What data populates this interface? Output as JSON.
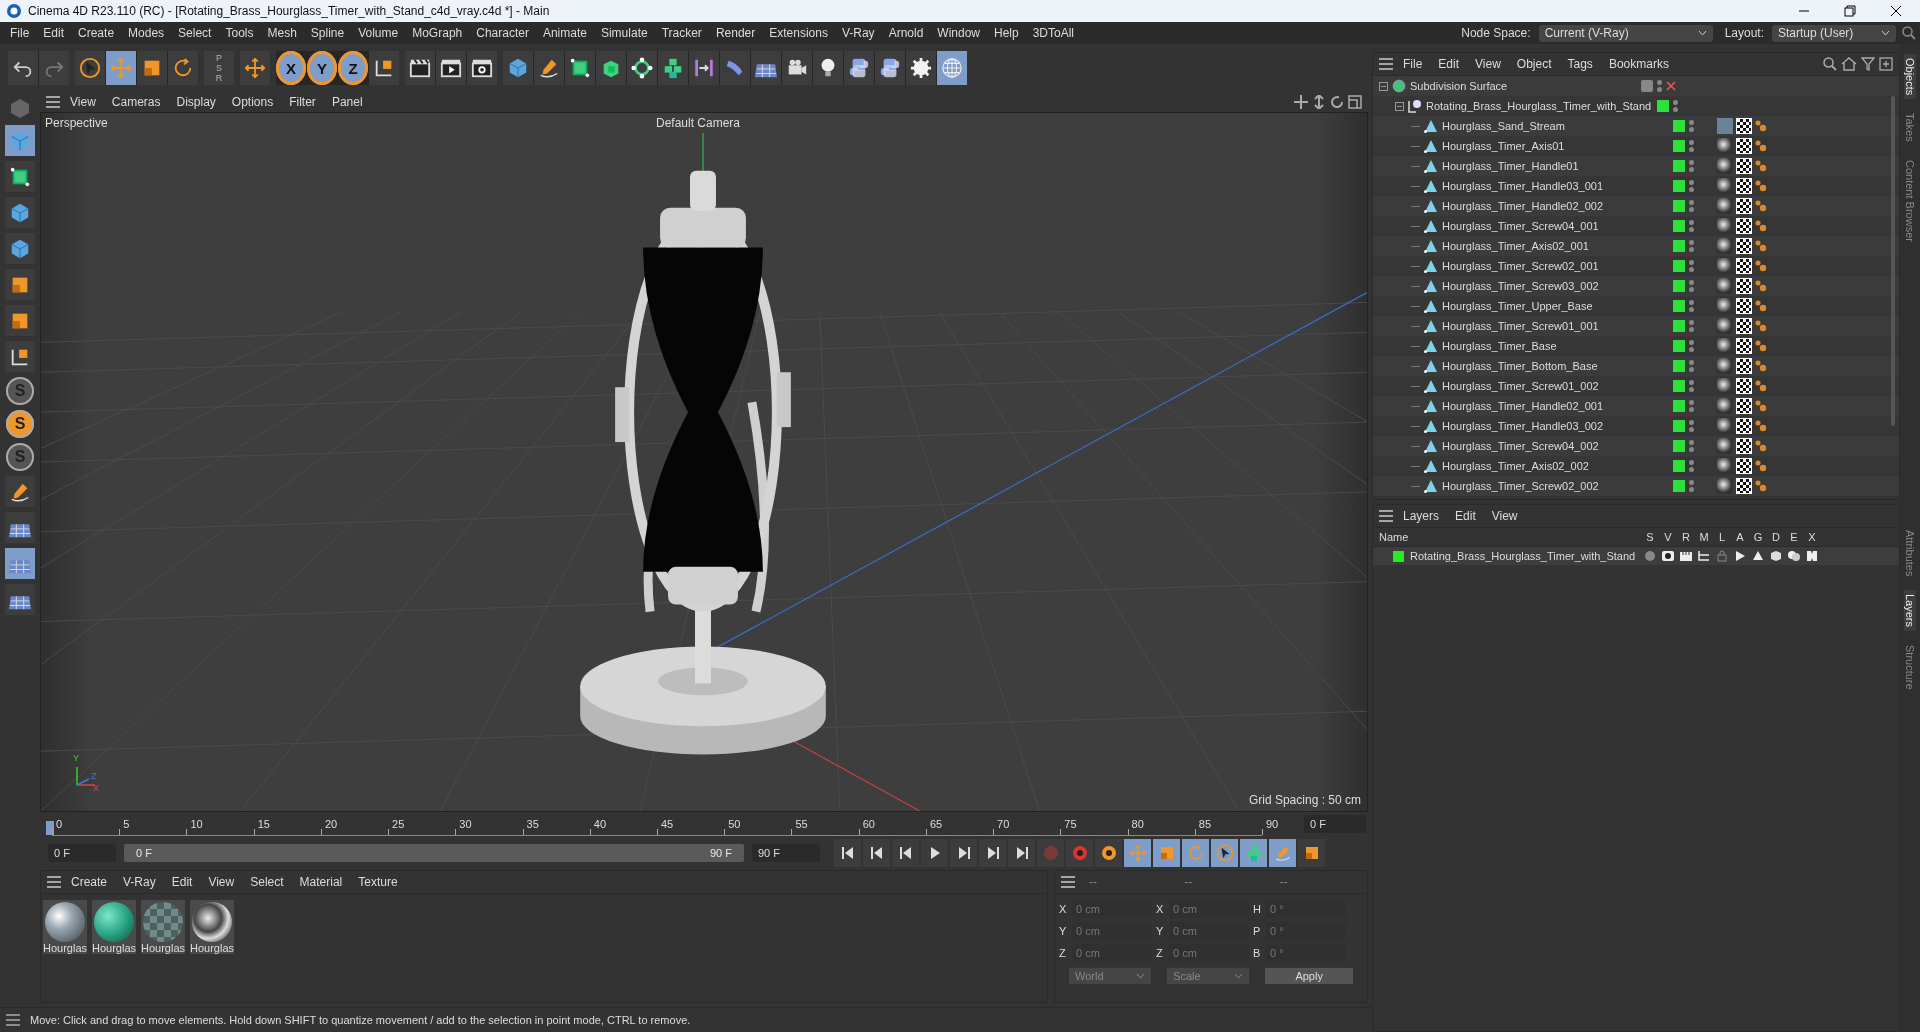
{
  "window": {
    "title": "Cinema 4D R23.110 (RC) - [Rotating_Brass_Hourglass_Timer_with_Stand_c4d_vray.c4d *] - Main"
  },
  "menu": [
    "File",
    "Edit",
    "Create",
    "Modes",
    "Select",
    "Tools",
    "Mesh",
    "Spline",
    "Volume",
    "MoGraph",
    "Character",
    "Animate",
    "Simulate",
    "Tracker",
    "Render",
    "Extensions",
    "V-Ray",
    "Arnold",
    "Window",
    "Help",
    "3DToAll"
  ],
  "node_space": {
    "label": "Node Space:",
    "value": "Current (V-Ray)"
  },
  "layout": {
    "label": "Layout:",
    "value": "Startup (User)"
  },
  "toolbar": {
    "psr_letters": [
      "P",
      "S",
      "R"
    ],
    "axis_buttons": [
      "X",
      "Y",
      "Z"
    ]
  },
  "left_toolbar": {
    "snap_letters": [
      "S",
      "S",
      "S"
    ]
  },
  "viewport": {
    "menu": [
      "View",
      "Cameras",
      "Display",
      "Options",
      "Filter",
      "Panel"
    ],
    "label": "Perspective",
    "camera": "Default Camera",
    "grid_spacing": "Grid Spacing : 50 cm",
    "axis_labels": [
      "Y",
      "Z",
      "X"
    ]
  },
  "timeline": {
    "ticks": [
      "0",
      "5",
      "10",
      "15",
      "20",
      "25",
      "30",
      "35",
      "40",
      "45",
      "50",
      "55",
      "60",
      "65",
      "70",
      "75",
      "80",
      "85",
      "90"
    ],
    "current_frame": "0 F",
    "start": "0 F",
    "range_start": "0 F",
    "range_end": "90 F",
    "range_level": {
      "level": 1
    },
    "end": "90 F"
  },
  "materials": {
    "menu": [
      "Create",
      "V-Ray",
      "Edit",
      "View",
      "Select",
      "Material",
      "Texture"
    ],
    "items": [
      {
        "name": "Hourglas",
        "kind": "glass"
      },
      {
        "name": "Hourglas",
        "kind": "green"
      },
      {
        "name": "Hourglas",
        "kind": "checker"
      },
      {
        "name": "Hourglas",
        "kind": "chrome"
      }
    ]
  },
  "coordinates": {
    "headers": [
      "--",
      "--",
      "--"
    ],
    "columns": [
      [
        {
          "label": "X",
          "placeholder": "0 cm"
        },
        {
          "label": "Y",
          "placeholder": "0 cm"
        },
        {
          "label": "Z",
          "placeholder": "0 cm"
        }
      ],
      [
        {
          "label": "X",
          "placeholder": "0 cm"
        },
        {
          "label": "Y",
          "placeholder": "0 cm"
        },
        {
          "label": "Z",
          "placeholder": "0 cm"
        }
      ],
      [
        {
          "label": "H",
          "placeholder": "0 °"
        },
        {
          "label": "P",
          "placeholder": "0 °"
        },
        {
          "label": "B",
          "placeholder": "0 °"
        }
      ]
    ],
    "dropdowns": [
      "World",
      "Scale"
    ],
    "apply": "Apply"
  },
  "objects": {
    "menu": [
      "File",
      "Edit",
      "View",
      "Object",
      "Tags",
      "Bookmarks"
    ],
    "tree": [
      {
        "name": "Subdivision Surface",
        "kind": "subdivision",
        "expanded": true,
        "children": [
          {
            "name": "Rotating_Brass_Hourglass_Timer_with_Stand",
            "kind": "null",
            "expanded": true,
            "children": [
              {
                "name": "Hourglass_Sand_Stream",
                "kind": "mesh",
                "tag": {
                  "kind": "sand"
                }
              },
              {
                "name": "Hourglass_Timer_Axis01",
                "kind": "mesh",
                "tag": {
                  "kind": "chrome"
                }
              },
              {
                "name": "Hourglass_Timer_Handle01",
                "kind": "mesh",
                "tag": {
                  "kind": "chrome"
                }
              },
              {
                "name": "Hourglass_Timer_Handle03_001",
                "kind": "mesh",
                "tag": {
                  "kind": "chrome"
                }
              },
              {
                "name": "Hourglass_Timer_Handle02_002",
                "kind": "mesh",
                "tag": {
                  "kind": "chrome"
                }
              },
              {
                "name": "Hourglass_Timer_Screw04_001",
                "kind": "mesh",
                "tag": {
                  "kind": "chrome"
                }
              },
              {
                "name": "Hourglass_Timer_Axis02_001",
                "kind": "mesh",
                "tag": {
                  "kind": "chrome"
                }
              },
              {
                "name": "Hourglass_Timer_Screw02_001",
                "kind": "mesh",
                "tag": {
                  "kind": "chrome"
                }
              },
              {
                "name": "Hourglass_Timer_Screw03_002",
                "kind": "mesh",
                "tag": {
                  "kind": "chrome"
                }
              },
              {
                "name": "Hourglass_Timer_Upper_Base",
                "kind": "mesh",
                "tag": {
                  "kind": "chrome"
                }
              },
              {
                "name": "Hourglass_Timer_Screw01_001",
                "kind": "mesh",
                "tag": {
                  "kind": "chrome"
                }
              },
              {
                "name": "Hourglass_Timer_Base",
                "kind": "mesh",
                "tag": {
                  "kind": "chrome"
                }
              },
              {
                "name": "Hourglass_Timer_Bottom_Base",
                "kind": "mesh",
                "tag": {
                  "kind": "chrome"
                }
              },
              {
                "name": "Hourglass_Timer_Screw01_002",
                "kind": "mesh",
                "tag": {
                  "kind": "chrome"
                }
              },
              {
                "name": "Hourglass_Timer_Handle02_001",
                "kind": "mesh",
                "tag": {
                  "kind": "chrome"
                }
              },
              {
                "name": "Hourglass_Timer_Handle03_002",
                "kind": "mesh",
                "tag": {
                  "kind": "chrome"
                }
              },
              {
                "name": "Hourglass_Timer_Screw04_002",
                "kind": "mesh",
                "tag": {
                  "kind": "chrome"
                }
              },
              {
                "name": "Hourglass_Timer_Axis02_002",
                "kind": "mesh",
                "tag": {
                  "kind": "chrome"
                }
              },
              {
                "name": "Hourglass_Timer_Screw02_002",
                "kind": "mesh",
                "tag": {
                  "kind": "chrome"
                }
              }
            ]
          }
        ]
      }
    ]
  },
  "layers": {
    "menu": [
      "Layers",
      "Edit",
      "View"
    ],
    "columns": [
      "Name",
      "S",
      "V",
      "R",
      "M",
      "L",
      "A",
      "G",
      "D",
      "E",
      "X"
    ],
    "rows": [
      {
        "name": "Rotating_Brass_Hourglass_Timer_with_Stand",
        "color": "#22ee22"
      }
    ]
  },
  "side_tabs": [
    {
      "label": "Objects",
      "selected": true
    },
    {
      "label": "Takes",
      "selected": false
    },
    {
      "label": "Content Browser",
      "selected": false
    },
    {
      "label": "Attributes",
      "selected": false
    },
    {
      "label": "Layers",
      "selected": true
    },
    {
      "label": "Structure",
      "selected": false
    }
  ],
  "status_bar": "Move: Click and drag to move elements. Hold down SHIFT to quantize movement / add to the selection in point mode, CTRL to remove."
}
